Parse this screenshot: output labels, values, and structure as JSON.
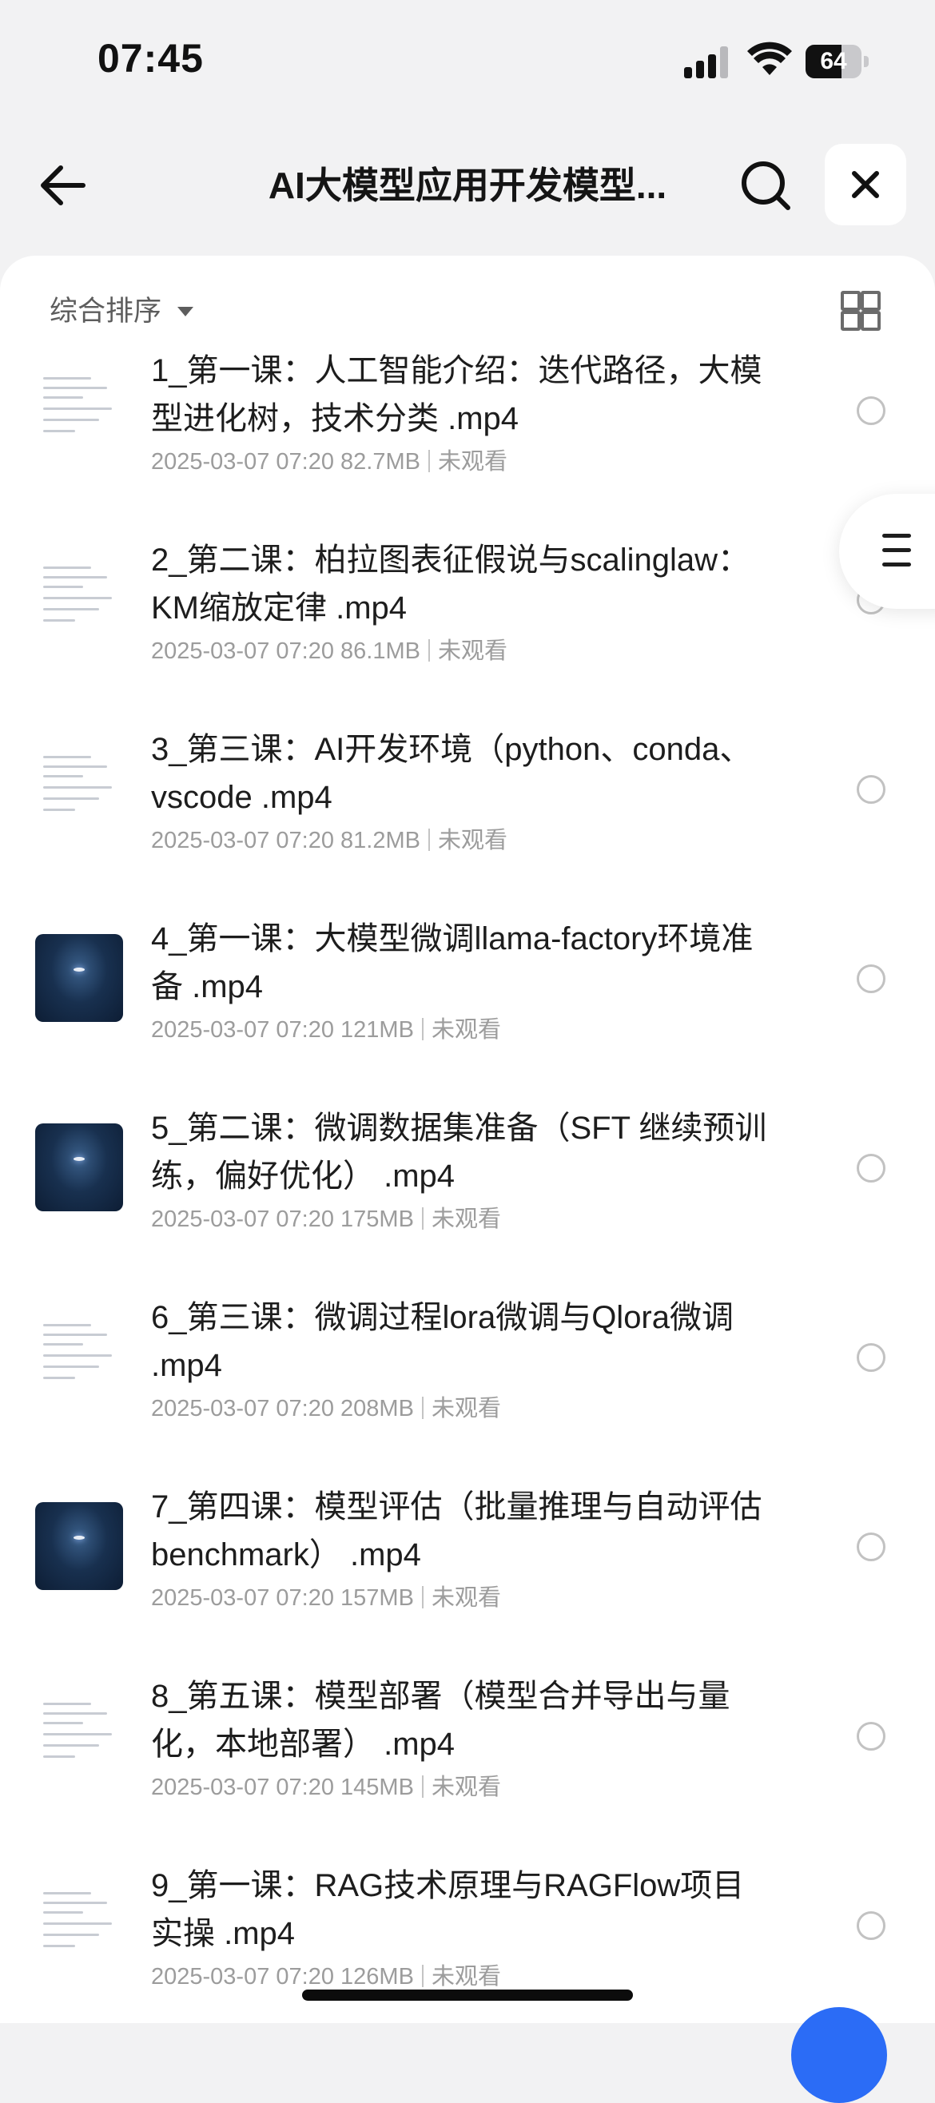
{
  "status_bar": {
    "time": "07:45",
    "battery": "64",
    "battery_level": 0.64
  },
  "header": {
    "title": "AI大模型应用开发模型..."
  },
  "toolbar": {
    "sort_label": "综合排序"
  },
  "files": [
    {
      "name": "1_第一课：人工智能介绍：迭代路径，大模型进化树，技术分类 .mp4",
      "date": "2025-03-07 07:20",
      "size": "82.7MB",
      "status": "未观看",
      "thumb": "doc"
    },
    {
      "name": "2_第二课：柏拉图表征假说与scalinglaw：KM缩放定律 .mp4",
      "date": "2025-03-07 07:20",
      "size": "86.1MB",
      "status": "未观看",
      "thumb": "doc"
    },
    {
      "name": "3_第三课：AI开发环境（python、conda、vscode .mp4",
      "date": "2025-03-07 07:20",
      "size": "81.2MB",
      "status": "未观看",
      "thumb": "doc"
    },
    {
      "name": "4_第一课：大模型微调llama-factory环境准备 .mp4",
      "date": "2025-03-07 07:20",
      "size": "121MB",
      "status": "未观看",
      "thumb": "dark"
    },
    {
      "name": "5_第二课：微调数据集准备（SFT 继续预训练，偏好优化） .mp4",
      "date": "2025-03-07 07:20",
      "size": "175MB",
      "status": "未观看",
      "thumb": "dark"
    },
    {
      "name": "6_第三课：微调过程lora微调与Qlora微调 .mp4",
      "date": "2025-03-07 07:20",
      "size": "208MB",
      "status": "未观看",
      "thumb": "doc"
    },
    {
      "name": "7_第四课：模型评估（批量推理与自动评估benchmark） .mp4",
      "date": "2025-03-07 07:20",
      "size": "157MB",
      "status": "未观看",
      "thumb": "dark"
    },
    {
      "name": "8_第五课：模型部署（模型合并导出与量化，本地部署） .mp4",
      "date": "2025-03-07 07:20",
      "size": "145MB",
      "status": "未观看",
      "thumb": "doc"
    },
    {
      "name": "9_第一课：RAG技术原理与RAGFlow项目实操 .mp4",
      "date": "2025-03-07 07:20",
      "size": "126MB",
      "status": "未观看",
      "thumb": "doc"
    }
  ]
}
